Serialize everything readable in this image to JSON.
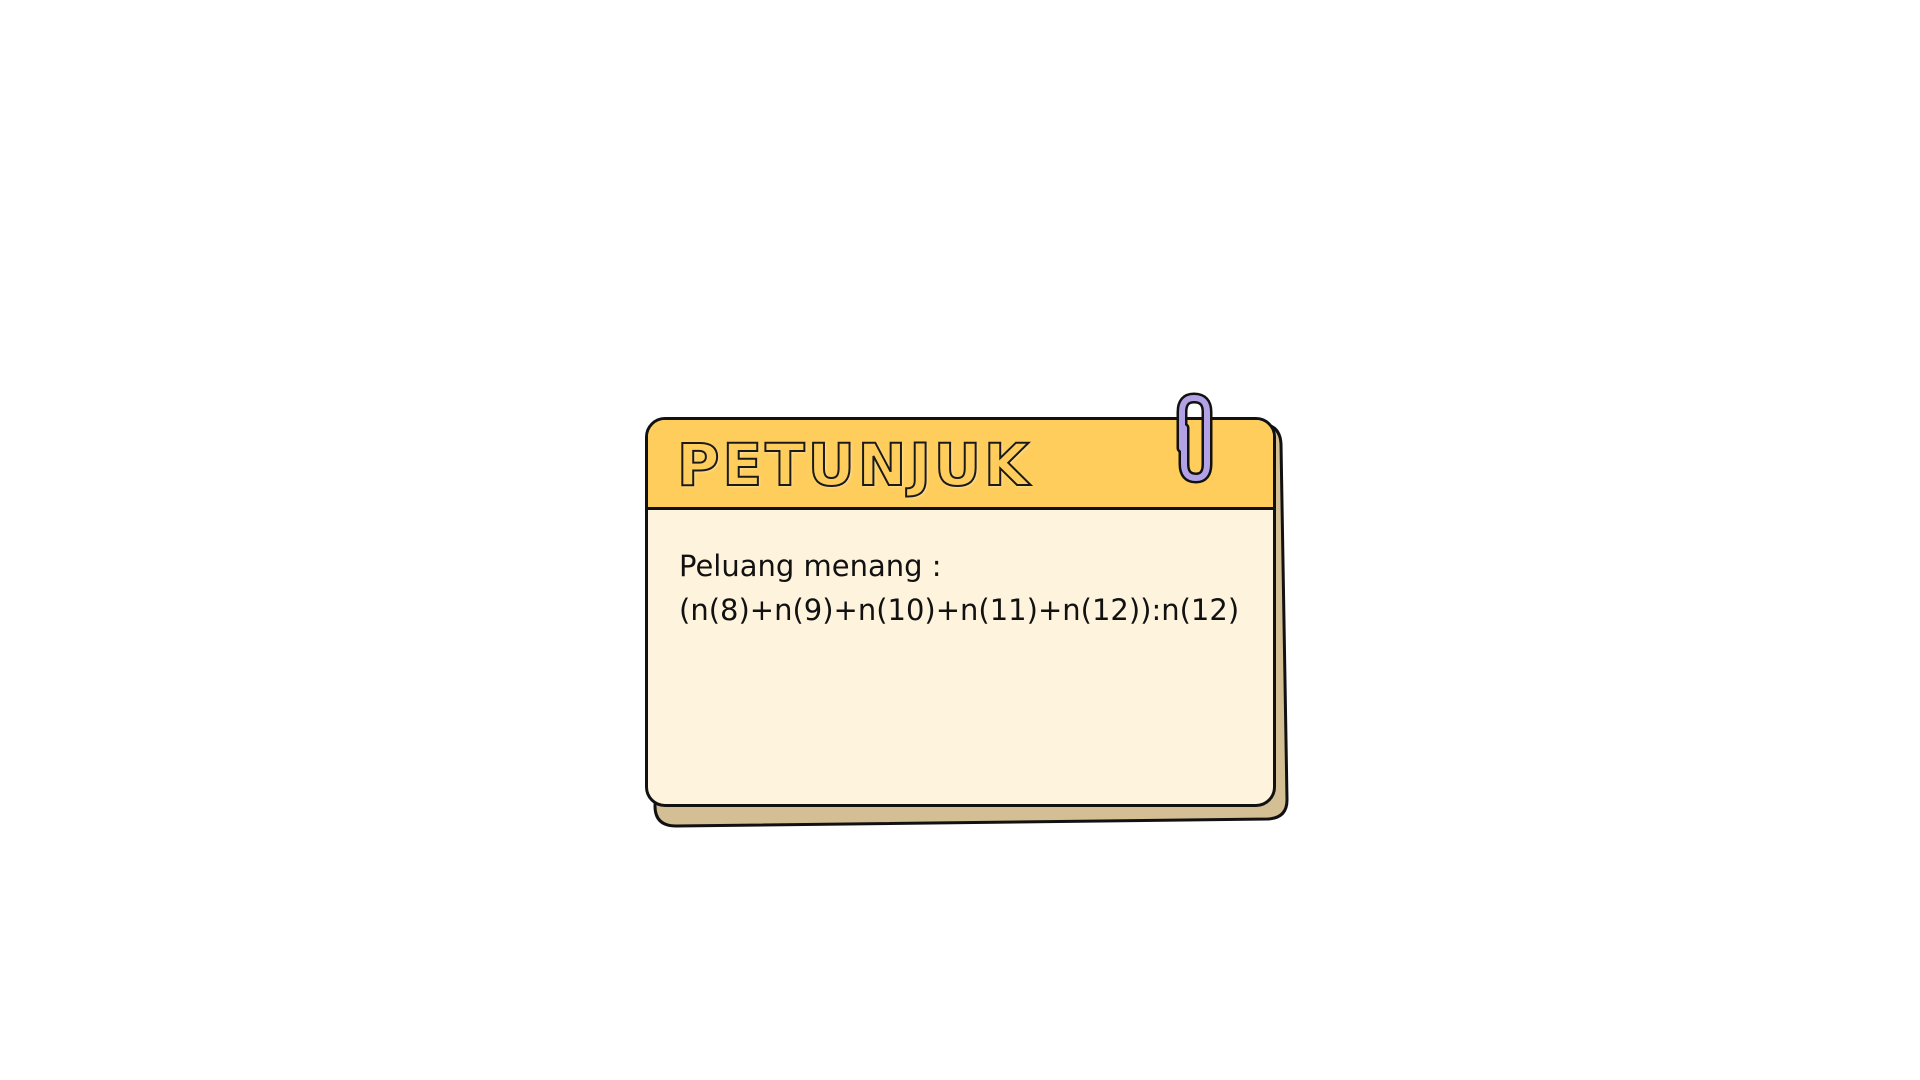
{
  "card": {
    "title": "PETUNJUK",
    "lines": [
      "Peluang menang :",
      "(n(8)+n(9)+n(10)+n(11)+n(12)):n(12)"
    ]
  },
  "colors": {
    "header": "#fecd5c",
    "body": "#fef3dc",
    "back_sheet": "#d4bf95",
    "outline": "#111111",
    "paperclip": "#b3a1e6"
  },
  "icons": {
    "clip": "paperclip-icon"
  }
}
